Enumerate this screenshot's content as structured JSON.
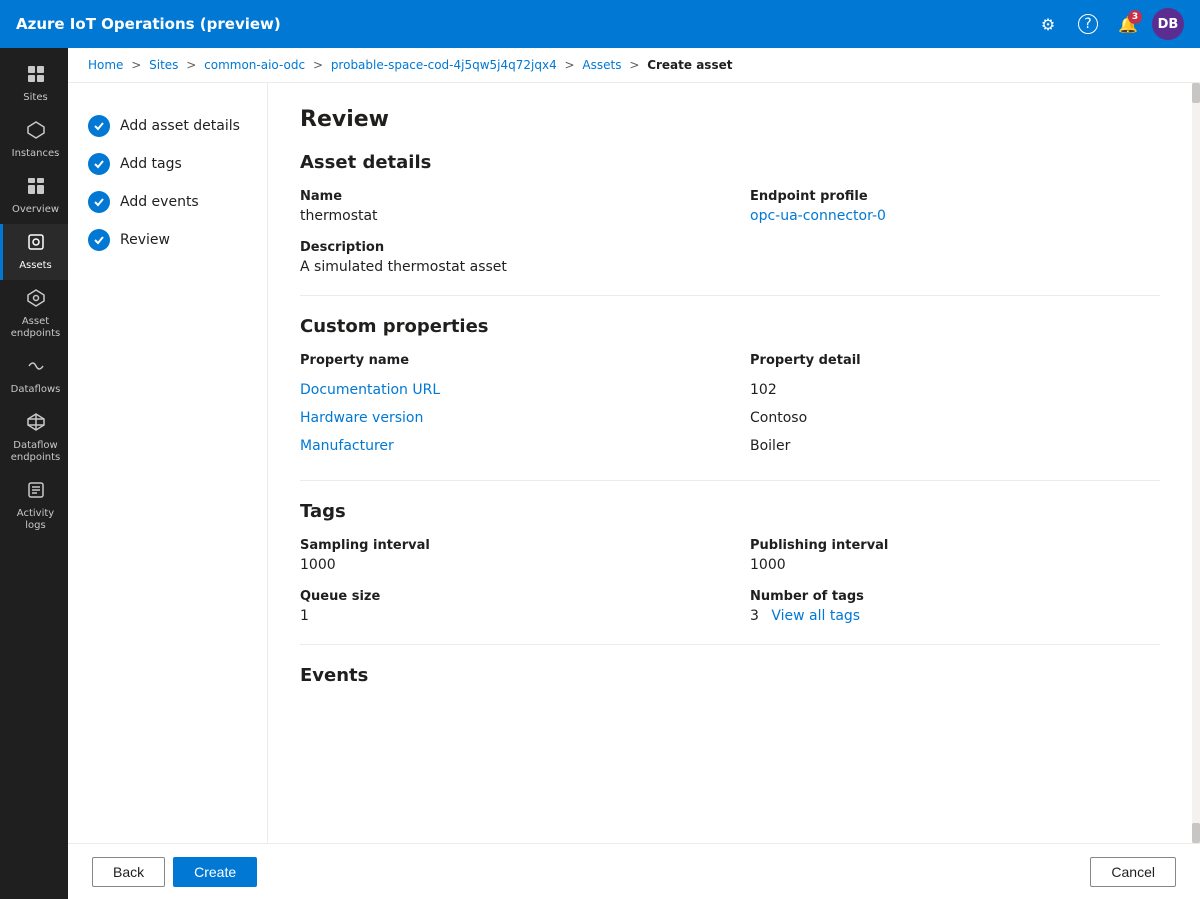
{
  "app": {
    "title": "Azure IoT Operations (preview)"
  },
  "topnav": {
    "title": "Azure IoT Operations (preview)",
    "icons": {
      "settings": "⚙",
      "help": "?",
      "notifications": "🔔",
      "notif_badge": "3",
      "avatar": "DB"
    }
  },
  "sidebar": {
    "items": [
      {
        "id": "sites",
        "label": "Sites",
        "icon": "⊞"
      },
      {
        "id": "instances",
        "label": "Instances",
        "icon": "⬡"
      },
      {
        "id": "overview",
        "label": "Overview",
        "icon": "▦"
      },
      {
        "id": "assets",
        "label": "Assets",
        "icon": "◈",
        "active": true
      },
      {
        "id": "asset-endpoints",
        "label": "Asset endpoints",
        "icon": "⬡"
      },
      {
        "id": "dataflows",
        "label": "Dataflows",
        "icon": "⇄"
      },
      {
        "id": "dataflow-endpoints",
        "label": "Dataflow endpoints",
        "icon": "⬡"
      },
      {
        "id": "activity-logs",
        "label": "Activity logs",
        "icon": "≡"
      }
    ]
  },
  "breadcrumb": {
    "parts": [
      "Home",
      "Sites",
      "common-aio-odc",
      "probable-space-cod-4j5qw5j4q72jqx4",
      "Assets",
      "Create asset"
    ],
    "separators": [
      ">",
      ">",
      ">",
      ">",
      ">"
    ],
    "current": "Create asset"
  },
  "steps": [
    {
      "id": "add-asset-details",
      "label": "Add asset details",
      "status": "completed"
    },
    {
      "id": "add-tags",
      "label": "Add tags",
      "status": "completed"
    },
    {
      "id": "add-events",
      "label": "Add events",
      "status": "completed"
    },
    {
      "id": "review",
      "label": "Review",
      "status": "active"
    }
  ],
  "review": {
    "title": "Review",
    "asset_details": {
      "section_title": "Asset details",
      "name_label": "Name",
      "name_value": "thermostat",
      "endpoint_profile_label": "Endpoint profile",
      "endpoint_profile_value": "opc-ua-connector-0",
      "description_label": "Description",
      "description_value": "A simulated thermostat asset"
    },
    "custom_properties": {
      "section_title": "Custom properties",
      "col1_header": "Property name",
      "col2_header": "Property detail",
      "rows": [
        {
          "name": "Documentation URL",
          "detail": "102"
        },
        {
          "name": "Hardware version",
          "detail": "Contoso"
        },
        {
          "name": "Manufacturer",
          "detail": "Boiler"
        }
      ]
    },
    "tags": {
      "section_title": "Tags",
      "sampling_interval_label": "Sampling interval",
      "sampling_interval_value": "1000",
      "publishing_interval_label": "Publishing interval",
      "publishing_interval_value": "1000",
      "queue_size_label": "Queue size",
      "queue_size_value": "1",
      "number_of_tags_label": "Number of tags",
      "number_of_tags_value": "3",
      "view_all_link": "View all tags"
    },
    "events": {
      "section_title": "Events"
    }
  },
  "bottom_bar": {
    "back_label": "Back",
    "create_label": "Create",
    "cancel_label": "Cancel"
  }
}
